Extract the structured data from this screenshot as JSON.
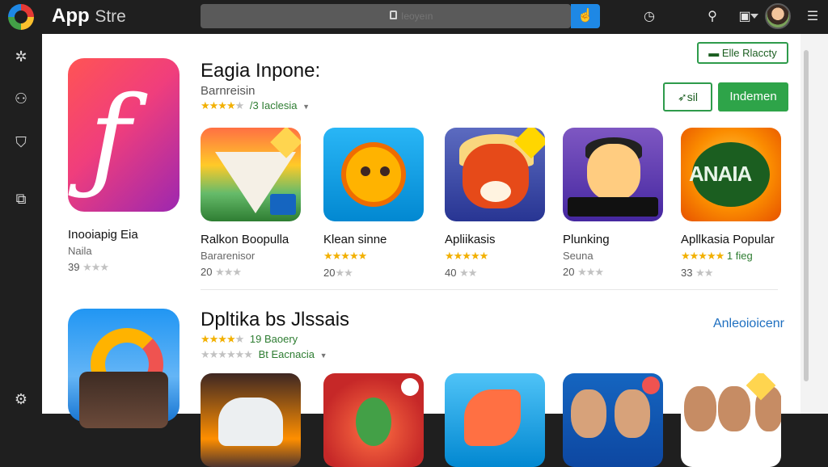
{
  "header": {
    "app_title_bold": "App",
    "app_title_light": "Stre",
    "search_placeholder": "Ieoyeın",
    "icons": [
      "chrome-logo",
      "lock-icon",
      "chevron-down-icon",
      "search-button-icon",
      "clock-icon",
      "wrench-icon",
      "panel-icon",
      "avatar",
      "menu-icon"
    ]
  },
  "sidebar": {
    "icons": [
      "apps-icon",
      "person-icon",
      "shield-icon",
      "cast-icon",
      "settings-icon"
    ]
  },
  "featured_1": {
    "title": "Eagia Inpone:",
    "subtitle": "Barnreisin",
    "stars": "★★★★",
    "stars_empty": "★",
    "rating_text": "/3 Iaclesia"
  },
  "actions": {
    "wishlist_label": "Elle Rlaccty",
    "share_label": "sil",
    "install_label": "Indemen"
  },
  "apps_row_1": [
    {
      "name": "Inooiapig Eia",
      "dev": "Naila",
      "rating": "39",
      "stars": "★★",
      "stars_empty": "★",
      "gold": false
    },
    {
      "name": "Ralkon Boopulla",
      "dev": "Bararenisor",
      "rating": "20",
      "stars": "★★",
      "stars_empty": "★",
      "gold": false
    },
    {
      "name": "Klean sinne",
      "dev": "",
      "rating": "20",
      "stars": "★★★★★",
      "stars_empty": "★★",
      "gold": true
    },
    {
      "name": "Apliikasis",
      "dev": "",
      "rating": "40",
      "stars": "★★★★★",
      "stars_empty": "★★",
      "gold": true
    },
    {
      "name": "Plunking",
      "dev": "Seuna",
      "rating": "20",
      "stars": "★★",
      "stars_empty": "★",
      "gold": false
    },
    {
      "name": "Apllkasia Popular",
      "dev": "1 fieg",
      "rating": "33",
      "stars": "★★★★★",
      "stars_empty": "★★",
      "gold": true
    }
  ],
  "featured_2": {
    "title": "Dpltika bs Jlssais",
    "stars": "★★★★",
    "stars_empty": "★",
    "rating_text": "19 Baoery",
    "stars2": "★★★★★★",
    "rating_text2": "Bt Eacnacia",
    "link_label": "Anleoioicenr"
  },
  "apps_row_2": [
    {
      "name": ""
    },
    {
      "name": ""
    },
    {
      "name": ""
    },
    {
      "name": ""
    },
    {
      "name": ""
    }
  ],
  "colors": {
    "accent": "#2ea449",
    "link": "#1e6fc0",
    "star": "#f2b000",
    "search_btn": "#1e88e5"
  }
}
